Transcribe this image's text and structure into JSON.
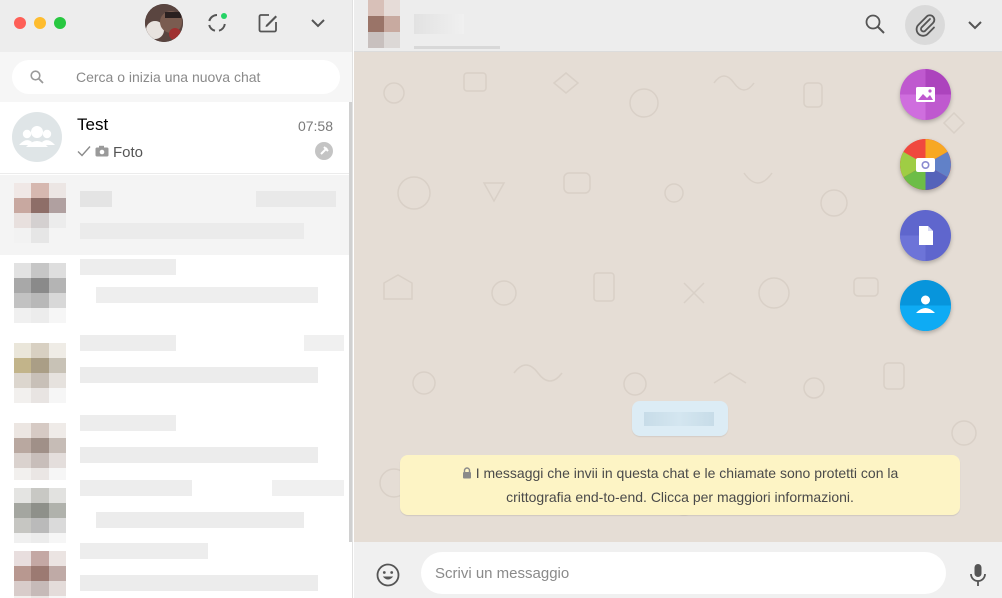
{
  "sidebar": {
    "search": {
      "placeholder": "Cerca o inizia una nuova chat",
      "icon": "search-icon"
    },
    "header_icons": [
      "avatar",
      "status-icon",
      "compose-icon",
      "chevron-down-icon"
    ],
    "chats": [
      {
        "name": "Test",
        "time": "07:58",
        "preview_icon": "camera-icon",
        "preview": "Foto",
        "status": "sent-check",
        "pinned": true
      }
    ]
  },
  "conversation": {
    "header_icons": [
      "search-icon",
      "paperclip-icon",
      "chevron-down-icon"
    ],
    "attach_options": [
      {
        "name": "photos-videos",
        "icon": "image-icon",
        "color": "#bf59cf"
      },
      {
        "name": "camera",
        "icon": "camera-icon",
        "color": "#f0483e"
      },
      {
        "name": "document",
        "icon": "document-icon",
        "color": "#5f66cd"
      },
      {
        "name": "contact",
        "icon": "contact-icon",
        "color": "#0795dc"
      }
    ],
    "encryption_notice": {
      "line1": "I messaggi che invii in questa chat e le chiamate sono protetti con la",
      "line2": "crittografia end-to-end. Clicca per maggiori informazioni."
    },
    "composer": {
      "placeholder": "Scrivi un messaggio"
    }
  },
  "colors": {
    "wallpaper": "#e5ddd5",
    "header_bg": "#ededed",
    "notice_bg": "#fdf4c5",
    "date_pill_bg": "#dcecf5"
  }
}
